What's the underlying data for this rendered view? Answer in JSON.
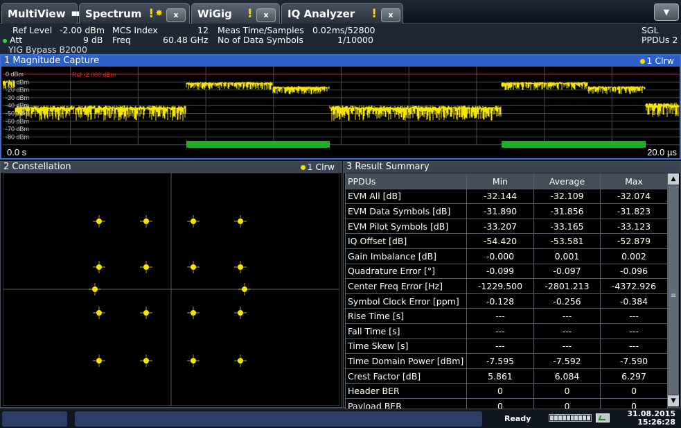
{
  "tabs": [
    {
      "label": "MultiView",
      "icon": "grid-icon"
    },
    {
      "label": "Spectrum",
      "warning": "!",
      "icon": "sweep-star-icon",
      "close": "x"
    },
    {
      "label": "WiGig",
      "warning": "!",
      "close": "x",
      "active": true
    },
    {
      "label": "IQ Analyzer",
      "warning": "!",
      "close": "x"
    }
  ],
  "tab_dropdown": "▼",
  "info": {
    "ref_level_label": "Ref Level",
    "ref_level_value": "-2.00 dBm",
    "att_label": "Att",
    "att_value": "9 dB",
    "yig": "YIG Bypass B2000",
    "mcs_label": "MCS Index",
    "mcs_value": "12",
    "freq_label": "Freq",
    "freq_value": "60.48 GHz",
    "meas_time_label": "Meas Time/Samples",
    "meas_time_value": "0.02ms/52800",
    "nsym_label": "No of Data Symbols",
    "nsym_value": "1/10000",
    "sgl": "SGL",
    "ppdus": "PPDUs 2"
  },
  "magnitude": {
    "title": "1 Magnitude Capture",
    "trace": "1 Clrw",
    "ref_label": "Ref -2.000 dBm",
    "y_ticks": [
      "0 dBm",
      "-10 dBm",
      "-20 dBm",
      "-30 dBm",
      "-40 dBm",
      "-50 dBm",
      "-60 dBm",
      "-70 dBm",
      "-80 dBm"
    ],
    "x_start": "0.0 s",
    "x_end": "20.0 µs",
    "colors": {
      "trace": "#f5e600",
      "ref": "#d02020",
      "burst": "#1fae2e",
      "grid": "#4a4a4a"
    }
  },
  "constellation": {
    "title": "2 Constellation",
    "trace": "1 Clrw",
    "point_color": "#f5e600"
  },
  "results": {
    "title": "3 Result Summary",
    "headers": [
      "PPDUs",
      "Min",
      "Average",
      "Max"
    ],
    "rows": [
      [
        "EVM All [dB]",
        "-32.144",
        "-32.109",
        "-32.074"
      ],
      [
        "EVM Data Symbols [dB]",
        "-31.890",
        "-31.856",
        "-31.823"
      ],
      [
        "EVM Pilot Symbols [dB]",
        "-33.207",
        "-33.165",
        "-33.123"
      ],
      [
        "IQ Offset [dB]",
        "-54.420",
        "-53.581",
        "-52.879"
      ],
      [
        "Gain Imbalance [dB]",
        "-0.000",
        "0.001",
        "0.002"
      ],
      [
        "Quadrature Error [°]",
        "-0.099",
        "-0.097",
        "-0.096"
      ],
      [
        "Center Freq Error [Hz]",
        "-1229.500",
        "-2801.213",
        "-4372.926"
      ],
      [
        "Symbol Clock Error [ppm]",
        "-0.128",
        "-0.256",
        "-0.384"
      ],
      [
        "Rise Time [s]",
        "---",
        "---",
        "---"
      ],
      [
        "Fall Time [s]",
        "---",
        "---",
        "---"
      ],
      [
        "Time Skew [s]",
        "---",
        "---",
        "---"
      ],
      [
        "Time Domain Power [dBm]",
        "-7.595",
        "-7.592",
        "-7.590"
      ],
      [
        "Crest Factor [dB]",
        "5.861",
        "6.084",
        "6.297"
      ],
      [
        "Header BER",
        "0",
        "0",
        "0"
      ],
      [
        "Payload BER",
        "0",
        "0",
        "0"
      ]
    ]
  },
  "status": {
    "state": "Ready",
    "date": "31.08.2015",
    "time": "15:26:28"
  }
}
